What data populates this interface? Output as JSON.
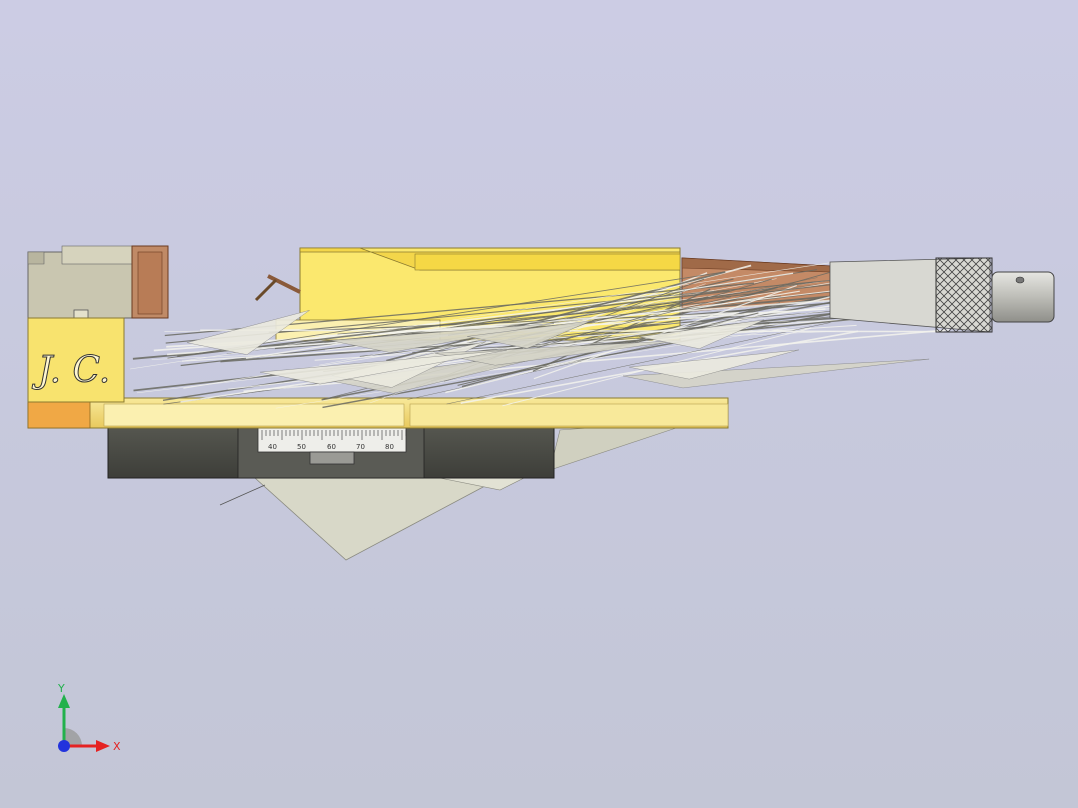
{
  "model": {
    "engraving": "J. C.",
    "scale_ticks": [
      "40",
      "50",
      "60",
      "70",
      "80"
    ]
  },
  "triad": {
    "x_label": "X",
    "y_label": "Y"
  },
  "colors": {
    "background_top": "#ccccE4",
    "background_bottom": "#c3c6d6",
    "vise_yellow": "#f4e27a",
    "vise_orange": "#f0a845",
    "base_dark": "#4a4b47",
    "jaw_brown": "#c08a66",
    "handle_silver": "#c9c9c4",
    "axis_x": "#e52222",
    "axis_y": "#22b14c",
    "axis_z": "#2233dd"
  },
  "icons": [
    "coordinate-triad-icon"
  ]
}
